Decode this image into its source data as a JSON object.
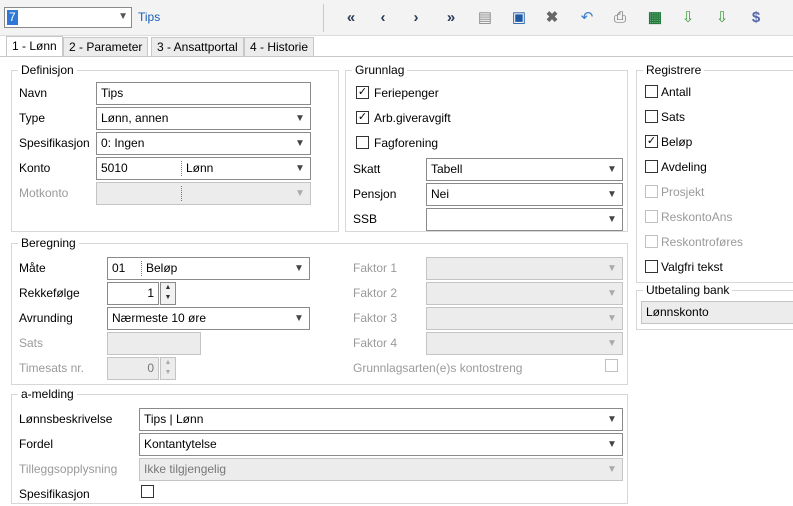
{
  "toolbar": {
    "record": "7",
    "title": "Tips",
    "icons": [
      "first-icon",
      "prev-icon",
      "next-icon",
      "last-icon",
      "new-document-icon",
      "save-icon",
      "delete-icon",
      "undo-icon",
      "print-icon",
      "excel-icon",
      "import-icon",
      "download-icon",
      "help-icon"
    ]
  },
  "tabs": [
    "1 - Lønn",
    "2 - Parameter",
    "3 - Ansattportal",
    "4 - Historie"
  ],
  "definisjon": {
    "title": "Definisjon",
    "navn_label": "Navn",
    "navn_value": "Tips",
    "type_label": "Type",
    "type_value": "Lønn, annen",
    "spes_label": "Spesifikasjon",
    "spes_value": "0:  Ingen",
    "konto_label": "Konto",
    "konto_code": "5010",
    "konto_name": "Lønn",
    "motkonto_label": "Motkonto"
  },
  "grunnlag": {
    "title": "Grunnlag",
    "ferie": "Feriepenger",
    "arb": "Arb.giveravgift",
    "fag": "Fagforening",
    "skatt_label": "Skatt",
    "skatt_value": "Tabell",
    "pensjon_label": "Pensjon",
    "pensjon_value": "Nei",
    "ssb_label": "SSB",
    "ssb_value": ""
  },
  "registrere": {
    "title": "Registrere",
    "items": [
      "Antall",
      "Sats",
      "Beløp",
      "Avdeling",
      "Prosjekt",
      "ReskontoAns",
      "Reskontroføres",
      "Valgfri tekst"
    ]
  },
  "utbetaling": {
    "title": "Utbetaling bank",
    "value": "Lønnskonto"
  },
  "beregning": {
    "title": "Beregning",
    "maate_label": "Måte",
    "maate_code": "01",
    "maate_name": "Beløp",
    "rekke_label": "Rekkefølge",
    "rekke_value": "1",
    "avrund_label": "Avrunding",
    "avrund_value": "Nærmeste 10 øre",
    "sats_label": "Sats",
    "timesats_label": "Timesats nr.",
    "timesats_value": "0",
    "faktor1": "Faktor 1",
    "faktor2": "Faktor 2",
    "faktor3": "Faktor 3",
    "faktor4": "Faktor 4",
    "grunnlagsart": "Grunnlagsarten(e)s kontostreng"
  },
  "amelding": {
    "title": "a-melding",
    "lonn_label": "Lønnsbeskrivelse",
    "lonn_value": "Tips | Lønn",
    "fordel_label": "Fordel",
    "fordel_value": "Kontantytelse",
    "tillegg_label": "Tilleggsopplysning",
    "tillegg_value": "Ikke tilgjengelig",
    "spes_label": "Spesifikasjon"
  }
}
